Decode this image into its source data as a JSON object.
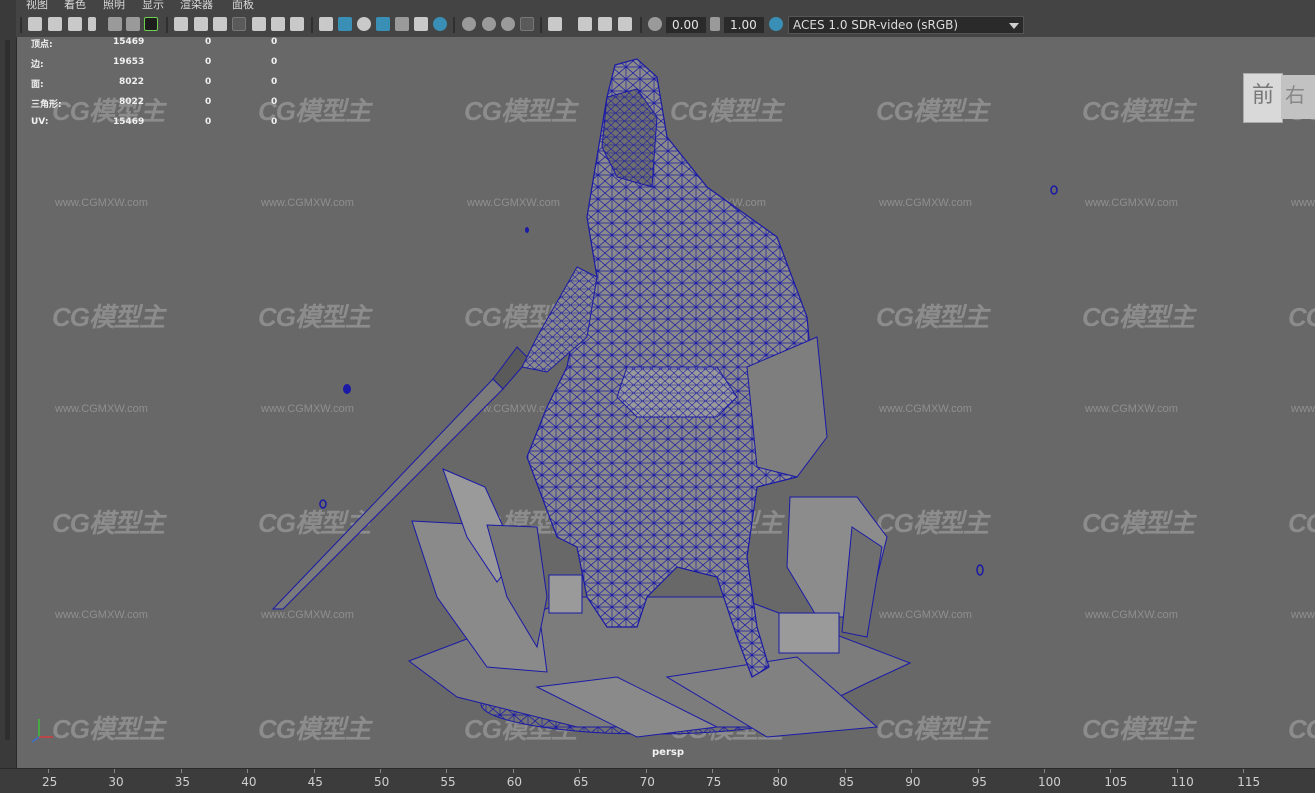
{
  "menu": [
    "视图",
    "着色",
    "照明",
    "显示",
    "渲染器",
    "面板"
  ],
  "toolbar": {
    "field_value_1": "0.00",
    "field_value_2": "1.00",
    "color_space": "ACES 1.0 SDR-video (sRGB)",
    "icons": [
      "camera-icon",
      "camera-attributes-icon",
      "bookmark-icon",
      "image-plane-icon",
      "grid-icon",
      "film-gate-icon",
      "resolution-gate-icon",
      "gate-mask-icon",
      "field-chart-icon",
      "safe-action-icon",
      "safe-title-icon",
      "wireframe-icon",
      "smooth-shade-icon",
      "default-lighting-icon",
      "xray-icon",
      "isolate-icon",
      "texture-icon",
      "lights-icon",
      "shadows-icon",
      "ambient-occlusion-icon",
      "antialias-icon",
      "depth-of-field-icon",
      "exposure-icon",
      "gamma-icon",
      "color-management-icon"
    ],
    "accent_blue": "#3a8fb7",
    "accent_green": "#6fd04f"
  },
  "hud": {
    "rows": [
      {
        "label": "顶点:",
        "v1": "15469",
        "v2": "0",
        "v3": "0"
      },
      {
        "label": "边:",
        "v1": "19653",
        "v2": "0",
        "v3": "0"
      },
      {
        "label": "面:",
        "v1": "8022",
        "v2": "0",
        "v3": "0"
      },
      {
        "label": "三角形:",
        "v1": "8022",
        "v2": "0",
        "v3": "0"
      },
      {
        "label": "UV:",
        "v1": "15469",
        "v2": "0",
        "v3": "0"
      }
    ]
  },
  "viewcube": {
    "front": "前",
    "right": "右"
  },
  "camera_label": "persp",
  "watermark": {
    "logo": "CG模型主",
    "url": "www.CGMXW.com"
  },
  "wireframe_color": "#1a1aa6",
  "timeline": [
    "25",
    "30",
    "35",
    "40",
    "45",
    "50",
    "55",
    "60",
    "65",
    "70",
    "75",
    "80",
    "85",
    "90",
    "95",
    "100",
    "105",
    "110",
    "115"
  ]
}
